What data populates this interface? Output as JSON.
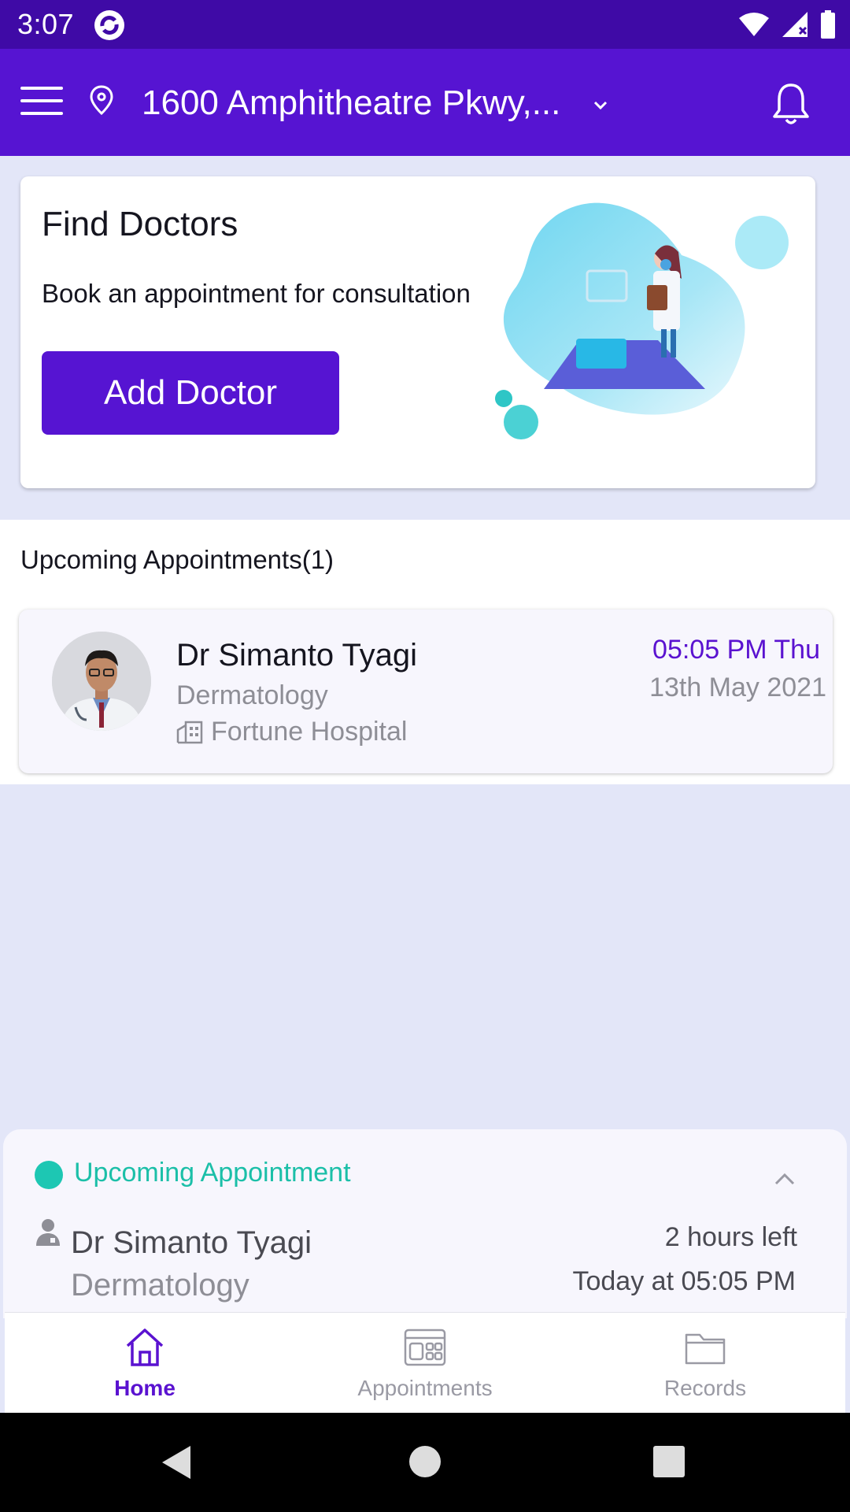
{
  "status_bar": {
    "time": "3:07"
  },
  "app_bar": {
    "location": "1600 Amphitheatre Pkwy,..."
  },
  "find_card": {
    "title": "Find Doctors",
    "subtitle": "Book an appointment for consultation",
    "button_label": "Add Doctor"
  },
  "upcoming": {
    "heading": "Upcoming Appointments(1)",
    "items": [
      {
        "doctor": "Dr Simanto Tyagi",
        "specialty": "Dermatology",
        "hospital": "Fortune Hospital",
        "time": "05:05 PM Thu",
        "date": "13th May 2021"
      }
    ]
  },
  "sheet": {
    "title": "Upcoming Appointment",
    "doctor": "Dr Simanto Tyagi",
    "specialty": "Dermatology",
    "time_left": "2 hours left",
    "when": "Today at 05:05 PM"
  },
  "bottom_nav": {
    "items": [
      {
        "label": "Home",
        "icon": "home-icon",
        "active": true
      },
      {
        "label": "Appointments",
        "icon": "calendar-icon",
        "active": false
      },
      {
        "label": "Records",
        "icon": "folder-icon",
        "active": false
      }
    ]
  },
  "colors": {
    "primary": "#5614d2",
    "status_bar": "#3f0aa6",
    "accent_teal": "#1bbfa8",
    "background": "#e3e6f8"
  }
}
